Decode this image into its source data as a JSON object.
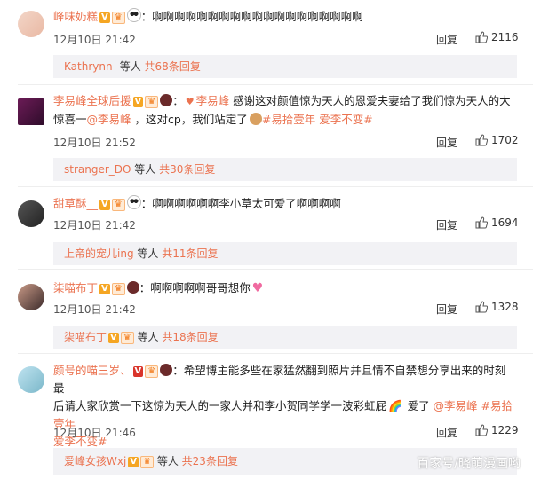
{
  "comments": [
    {
      "username": "峰味奶糕",
      "text": "：啊啊啊啊啊啊啊啊啊啊啊啊啊啊啊啊啊啊啊",
      "time": "12月10日 21:42",
      "reply_label": "回复",
      "likes": "2116",
      "replies": {
        "who": "Kathrynn-",
        "mid": " 等人 ",
        "count": "共68条回复"
      }
    },
    {
      "username": "李易峰全球后援",
      "mention_inline": "李易峰",
      "text_line1": " 感谢这对颜值惊为天人的恩爱夫妻给了我们惊为天人的大",
      "text_line2a": "惊喜一",
      "mention2": "@李易峰",
      "text_line2b": " ，这对cp，我们站定了",
      "topic1": "#易拾壹年",
      "topic2": "爱李不变#",
      "time": "12月10日 21:52",
      "reply_label": "回复",
      "likes": "1702",
      "replies": {
        "who": "stranger_DO",
        "mid": " 等人 ",
        "count": "共30条回复"
      }
    },
    {
      "username": "甜草酥__",
      "text": "：啊啊啊啊啊啊李小草太可爱了啊啊啊啊",
      "time": "12月10日 21:42",
      "reply_label": "回复",
      "likes": "1694",
      "replies": {
        "who": "上帝的宠儿ing",
        "mid": " 等人 ",
        "count": "共11条回复"
      }
    },
    {
      "username": "柒喵布丁",
      "text": "：啊啊啊啊啊哥哥想你",
      "time": "12月10日 21:42",
      "reply_label": "回复",
      "likes": "1328",
      "replies": {
        "who": "柒喵布丁",
        "mid": " 等人 ",
        "count": "共18条回复"
      }
    },
    {
      "username": "颜号的喵三岁、",
      "text_line1": "：希望博主能多些在家猛然翻到照片并且情不自禁想分享出来的时刻 最",
      "text_line2": "后请大家欣赏一下这惊为天人的一家人并和李小贺同学学一波彩虹屁",
      "text_line2b": " 爱了 ",
      "mention": "@李易峰",
      "topic1": " #易拾壹年",
      "topic2": "爱李不变#",
      "time": "12月10日 21:46",
      "reply_label": "回复",
      "likes": "1229",
      "replies": {
        "who": "爱峰女孩Wxj",
        "mid": " 等人 ",
        "count": "共23条回复"
      }
    }
  ],
  "badges": {
    "v": "V",
    "level": "♛"
  },
  "watermark": "百家号/晓萌漫画哟",
  "colors": {
    "accent": "#eb7350",
    "sub_bg": "#f2f2f5"
  }
}
